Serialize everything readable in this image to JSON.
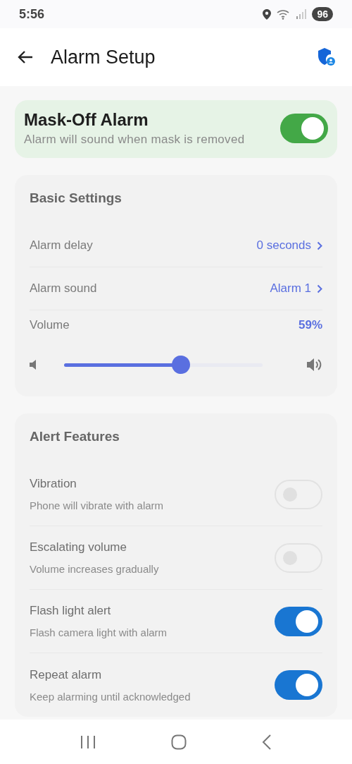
{
  "status_bar": {
    "time": "5:56",
    "battery": "96"
  },
  "app_bar": {
    "title": "Alarm Setup"
  },
  "master": {
    "title": "Mask-Off Alarm",
    "subtitle": "Alarm will sound when mask is removed",
    "on": true
  },
  "basic_settings": {
    "title": "Basic Settings",
    "rows": [
      {
        "label": "Alarm delay",
        "value": "0 seconds"
      },
      {
        "label": "Alarm sound",
        "value": "Alarm 1"
      }
    ],
    "volume": {
      "label": "Volume",
      "reading": "59%",
      "level": 0.59
    }
  },
  "alert_features": {
    "title": "Alert Features",
    "items": [
      {
        "label": "Vibration",
        "description": "Phone will vibrate with alarm",
        "on": false
      },
      {
        "label": "Escalating volume",
        "description": "Volume increases gradually",
        "on": false
      },
      {
        "label": "Flash light alert",
        "description": "Flash camera light with alarm",
        "on": true
      },
      {
        "label": "Repeat alarm",
        "description": "Keep alarming until acknowledged",
        "on": true
      }
    ]
  }
}
